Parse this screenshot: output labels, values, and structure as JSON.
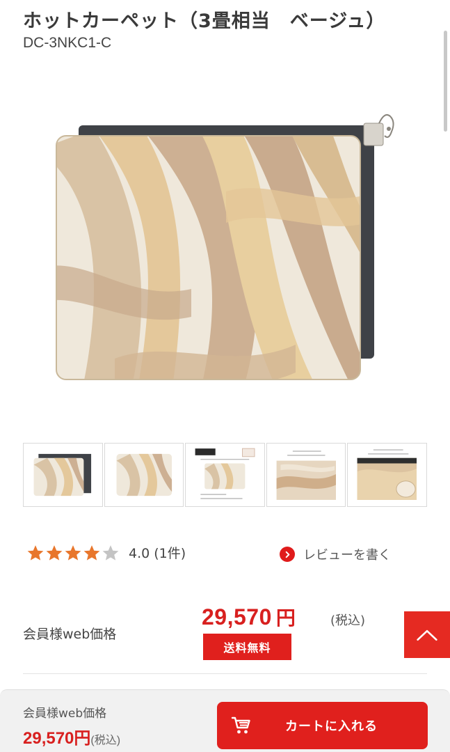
{
  "product": {
    "title": "ホットカーペット（3畳相当　ベージュ）",
    "model": "DC-3NKC1-C"
  },
  "thumbnails": [
    {
      "icon": "carpet-with-backing-thumb"
    },
    {
      "icon": "carpet-top-thumb"
    },
    {
      "icon": "product-spec-thumb",
      "badge": "3畳相当"
    },
    {
      "icon": "carpet-detail-thumb"
    },
    {
      "icon": "carpet-roll-thumb"
    }
  ],
  "rating": {
    "stars_filled": 4,
    "stars_total": 5,
    "text": "4.0 (1件)"
  },
  "review": {
    "label": "レビューを書く"
  },
  "price": {
    "label": "会員様web価格",
    "amount": "29,570",
    "currency": "円",
    "tax": "(税込)",
    "shipping_badge": "送料無料"
  },
  "bottom_bar": {
    "label": "会員様web価格",
    "price": "29,570円",
    "tax": "(税込)",
    "cart_label": "カートに入れる"
  },
  "colors": {
    "accent_red": "#e0201d",
    "price_red": "#d8201f",
    "star_orange": "#e8762b",
    "star_empty": "#c4c4c4"
  }
}
